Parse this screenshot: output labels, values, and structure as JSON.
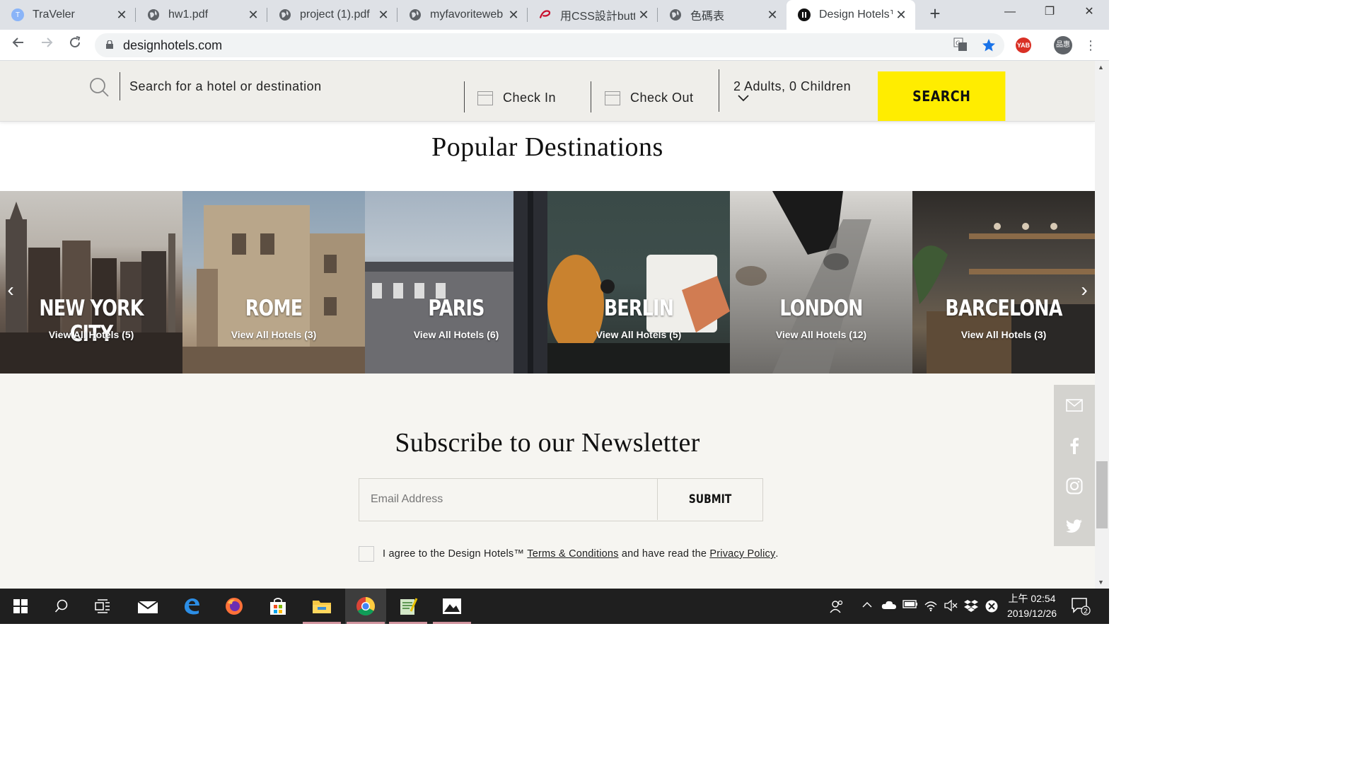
{
  "browser": {
    "tabs": [
      {
        "title": "TraVeler",
        "favicon": "traveler-favicon",
        "favicon_text": "T",
        "active": false
      },
      {
        "title": "hw1.pdf",
        "favicon": "globe-favicon",
        "active": false
      },
      {
        "title": "project (1).pdf",
        "favicon": "globe-favicon",
        "active": false
      },
      {
        "title": "myfavoriteweb",
        "favicon": "globe-favicon",
        "active": false
      },
      {
        "title": "用CSS設計butto",
        "favicon": "red-logo-favicon",
        "active": false
      },
      {
        "title": "色碼表",
        "favicon": "globe-favicon",
        "active": false
      },
      {
        "title": "Design Hotels™",
        "favicon": "design-hotels-favicon",
        "active": true
      }
    ],
    "new_tab_label": "+",
    "window_controls": {
      "minimize": "—",
      "restore": "❐",
      "close": "✕"
    },
    "url": "designhotels.com",
    "omni_icons": {
      "translate": "translate-icon",
      "bookmark": "star-icon",
      "extension_label": "YAB",
      "profile_label": "品惠"
    }
  },
  "page": {
    "search_bar": {
      "placeholder": "Search for a hotel or destination",
      "check_in": "Check In",
      "check_out": "Check Out",
      "guests": "2 Adults, 0 Children",
      "search_button": "SEARCH",
      "search_button_color": "#ffed00"
    },
    "popular_title": "Popular Destinations",
    "destinations": [
      {
        "name": "NEW YORK CITY",
        "subtitle": "View All Hotels (5)"
      },
      {
        "name": "ROME",
        "subtitle": "View All Hotels (3)"
      },
      {
        "name": "PARIS",
        "subtitle": "View All Hotels (6)"
      },
      {
        "name": "BERLIN",
        "subtitle": "View All Hotels (5)"
      },
      {
        "name": "LONDON",
        "subtitle": "View All Hotels (12)"
      },
      {
        "name": "BARCELONA",
        "subtitle": "View All Hotels (3)"
      }
    ],
    "carousel": {
      "prev_icon": "‹",
      "next_icon": "›"
    },
    "newsletter": {
      "title": "Subscribe to our Newsletter",
      "email_placeholder": "Email Address",
      "submit_label": "SUBMIT",
      "agree_prefix": "I agree to the Design Hotels™ ",
      "terms_link": "Terms & Conditions",
      "agree_middle": " and have read the ",
      "privacy_link": "Privacy Policy",
      "agree_suffix": "."
    },
    "social": [
      "mail-icon",
      "facebook-icon",
      "instagram-icon",
      "twitter-icon"
    ]
  },
  "taskbar": {
    "apps": [
      "start-icon",
      "search-icon",
      "task-view-icon",
      "mail-icon",
      "edge-icon",
      "firefox-icon",
      "store-icon",
      "file-explorer-icon",
      "chrome-icon",
      "notepad-icon",
      "photos-icon"
    ],
    "active_app": "chrome-icon",
    "clock_time": "上午 02:54",
    "clock_date": "2019/12/26",
    "notification_count": "2"
  }
}
